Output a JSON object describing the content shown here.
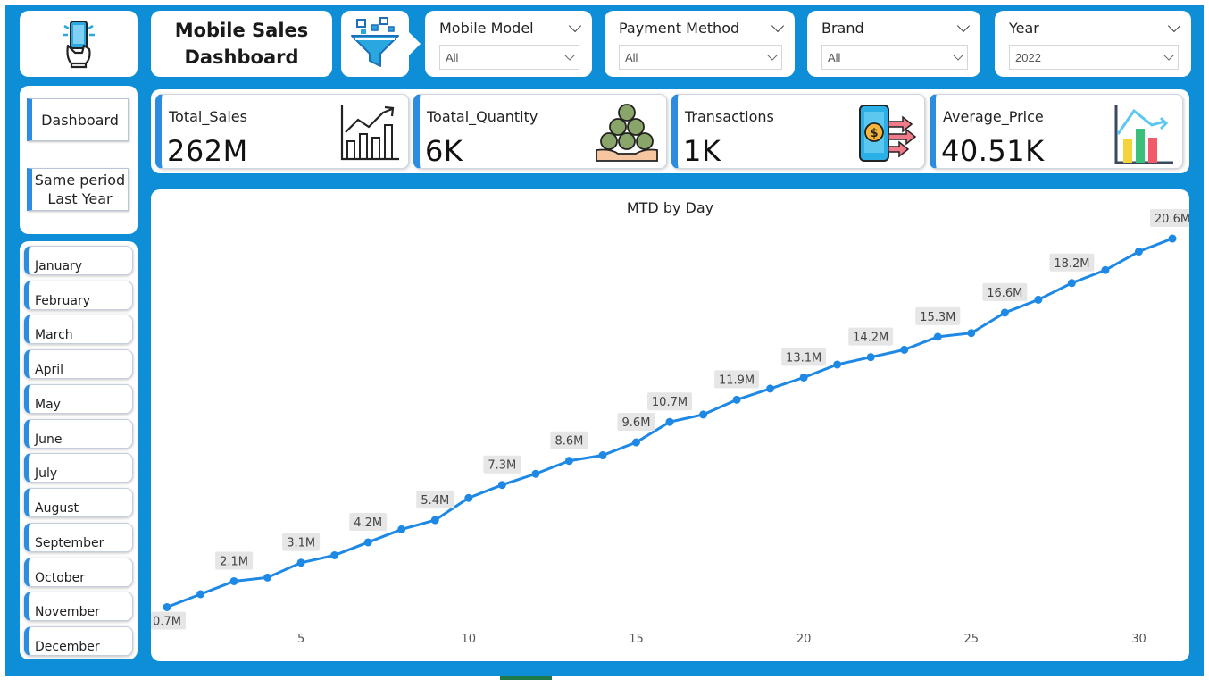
{
  "header": {
    "title_line1": "Mobile Sales",
    "title_line2": "Dashboard"
  },
  "icons": {
    "logo": "mobile-hand-icon",
    "filter": "funnel-filter-icon"
  },
  "slicers": [
    {
      "label": "Mobile Model",
      "value": "All"
    },
    {
      "label": "Payment Method",
      "value": "All"
    },
    {
      "label": "Brand",
      "value": "All"
    },
    {
      "label": "Year",
      "value": "2022"
    }
  ],
  "nav": {
    "dashboard": "Dashboard",
    "same_period_line1": "Same period",
    "same_period_line2": "Last Year"
  },
  "months": [
    "January",
    "February",
    "March",
    "April",
    "May",
    "June",
    "July",
    "August",
    "September",
    "October",
    "November",
    "December"
  ],
  "kpis": [
    {
      "label": "Total_Sales",
      "value": "262M",
      "icon": "growth-chart-icon"
    },
    {
      "label": "Toatal_Quantity",
      "value": "6K",
      "icon": "money-bags-icon"
    },
    {
      "label": "Transactions",
      "value": "1K",
      "icon": "mobile-payment-icon"
    },
    {
      "label": "Average_Price",
      "value": "40.51K",
      "icon": "bar-chart-arrow-icon"
    }
  ],
  "colors": {
    "background": "#0e8ed6",
    "accent": "#2b8ce0",
    "line": "#1e88e5"
  },
  "chart_data": {
    "type": "line",
    "title": "MTD by Day",
    "xlabel": "",
    "ylabel": "",
    "x_ticks": [
      5,
      10,
      15,
      20,
      25,
      30
    ],
    "xlim": [
      1,
      31
    ],
    "ylim": [
      0,
      22
    ],
    "grid": false,
    "series": [
      {
        "x": [
          1,
          2,
          3,
          4,
          5,
          6,
          7,
          8,
          9,
          10,
          11,
          12,
          13,
          14,
          15,
          16,
          17,
          18,
          19,
          20,
          21,
          22,
          23,
          24,
          25,
          26,
          27,
          28,
          29,
          30,
          31
        ],
        "values": [
          0.7,
          1.4,
          2.1,
          2.3,
          3.1,
          3.5,
          4.2,
          4.9,
          5.4,
          6.6,
          7.3,
          7.9,
          8.6,
          8.9,
          9.6,
          10.7,
          11.1,
          11.9,
          12.5,
          13.1,
          13.8,
          14.2,
          14.6,
          15.3,
          15.5,
          16.6,
          17.3,
          18.2,
          18.9,
          19.9,
          20.6
        ]
      }
    ],
    "data_labels": [
      {
        "x": 1,
        "text": "0.7M"
      },
      {
        "x": 3,
        "text": "2.1M"
      },
      {
        "x": 5,
        "text": "3.1M"
      },
      {
        "x": 7,
        "text": "4.2M"
      },
      {
        "x": 9,
        "text": "5.4M"
      },
      {
        "x": 11,
        "text": "7.3M"
      },
      {
        "x": 13,
        "text": "8.6M"
      },
      {
        "x": 15,
        "text": "9.6M"
      },
      {
        "x": 16,
        "text": "10.7M"
      },
      {
        "x": 18,
        "text": "11.9M"
      },
      {
        "x": 20,
        "text": "13.1M"
      },
      {
        "x": 22,
        "text": "14.2M"
      },
      {
        "x": 24,
        "text": "15.3M"
      },
      {
        "x": 26,
        "text": "16.6M"
      },
      {
        "x": 28,
        "text": "18.2M"
      },
      {
        "x": 31,
        "text": "20.6M"
      }
    ]
  }
}
